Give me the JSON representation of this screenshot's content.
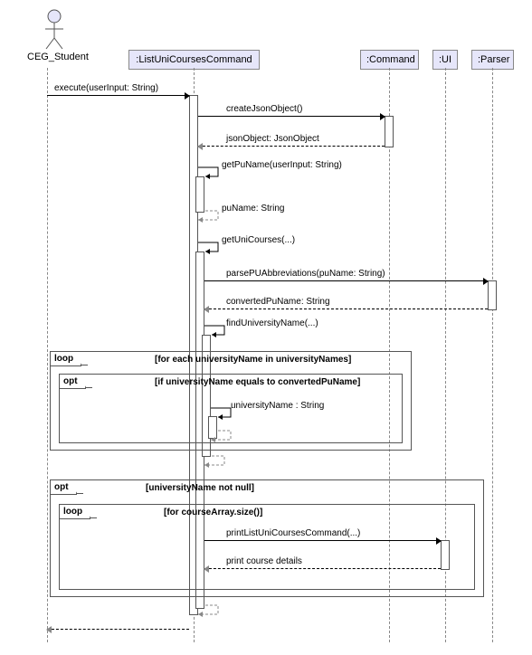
{
  "actor": {
    "name": "CEG_Student"
  },
  "participants": {
    "listUniCoursesCommand": ":ListUniCoursesCommand",
    "command": ":Command",
    "ui": ":UI",
    "parser": ":Parser"
  },
  "messages": {
    "execute": "execute(userInput: String)",
    "createJsonObject": "createJsonObject()",
    "jsonObjectReturn": "jsonObject: JsonObject",
    "getPuName": "getPuName(userInput: String)",
    "puNameReturn": "puName: String",
    "getUniCourses": "getUniCourses(...)",
    "parsePUAbbreviations": "parsePUAbbreviations(puName: String)",
    "convertedPuNameReturn": "convertedPuName: String",
    "findUniversityName": "findUniversityName(...)",
    "universityNameReturn": "universityName : String",
    "printListUniCoursesCommand": "printListUniCoursesCommand(...)",
    "printCourseDetails": "print course details"
  },
  "frames": {
    "loop1": {
      "label": "loop",
      "guard": "[for each universityName in universityNames]"
    },
    "opt1": {
      "label": "opt",
      "guard": "[if universityName equals to convertedPuName]"
    },
    "opt2": {
      "label": "opt",
      "guard": "[universityName not null]"
    },
    "loop2": {
      "label": "loop",
      "guard": "[for courseArray.size()]"
    }
  }
}
